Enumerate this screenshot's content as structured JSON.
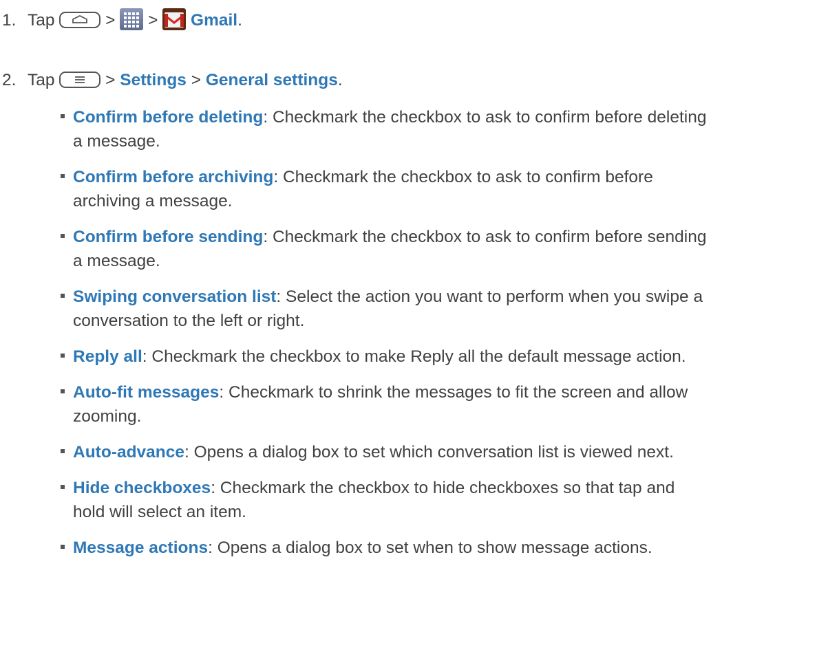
{
  "steps": [
    {
      "number": "1.",
      "tap": "Tap",
      "sep1": ">",
      "sep2": ">",
      "app": "Gmail",
      "end": "."
    },
    {
      "number": "2.",
      "tap": "Tap",
      "sep1": ">",
      "settings": "Settings",
      "sep2": ">",
      "general": "General settings",
      "end": "."
    }
  ],
  "icons": {
    "home": "home-key-icon",
    "apps": "apps-grid-icon",
    "gmail": "gmail-icon",
    "menu": "menu-key-icon"
  },
  "colors": {
    "accent": "#2f78b6",
    "text": "#414141"
  },
  "bullets": [
    {
      "term": "Confirm before deleting",
      "line1": ": Checkmark the checkbox to ask to confirm before deleting",
      "line2": "a message."
    },
    {
      "term": "Confirm before archiving",
      "line1": ": Checkmark the checkbox to ask to confirm before",
      "line2": "archiving a message."
    },
    {
      "term": "Confirm before sending",
      "line1": ": Checkmark the checkbox to ask to confirm before sending",
      "line2": "a message."
    },
    {
      "term": "Swiping conversation list",
      "line1": ": Select the action you want to perform when you swipe a",
      "line2": "conversation to the left or right."
    },
    {
      "term": "Reply all",
      "line1": ": Checkmark the checkbox to make Reply all the default message action.",
      "line2": ""
    },
    {
      "term": "Auto-fit messages",
      "line1": ": Checkmark to shrink the messages to fit the screen and allow",
      "line2": "zooming."
    },
    {
      "term": "Auto-advance",
      "line1": ": Opens a dialog box to set which conversation list is viewed next.",
      "line2": ""
    },
    {
      "term": "Hide checkboxes",
      "line1": ": Checkmark the checkbox to hide checkboxes so that tap and",
      "line2": "hold will select an item."
    },
    {
      "term": "Message actions",
      "line1": ": Opens a dialog box to set when to show message actions.",
      "line2": ""
    }
  ]
}
